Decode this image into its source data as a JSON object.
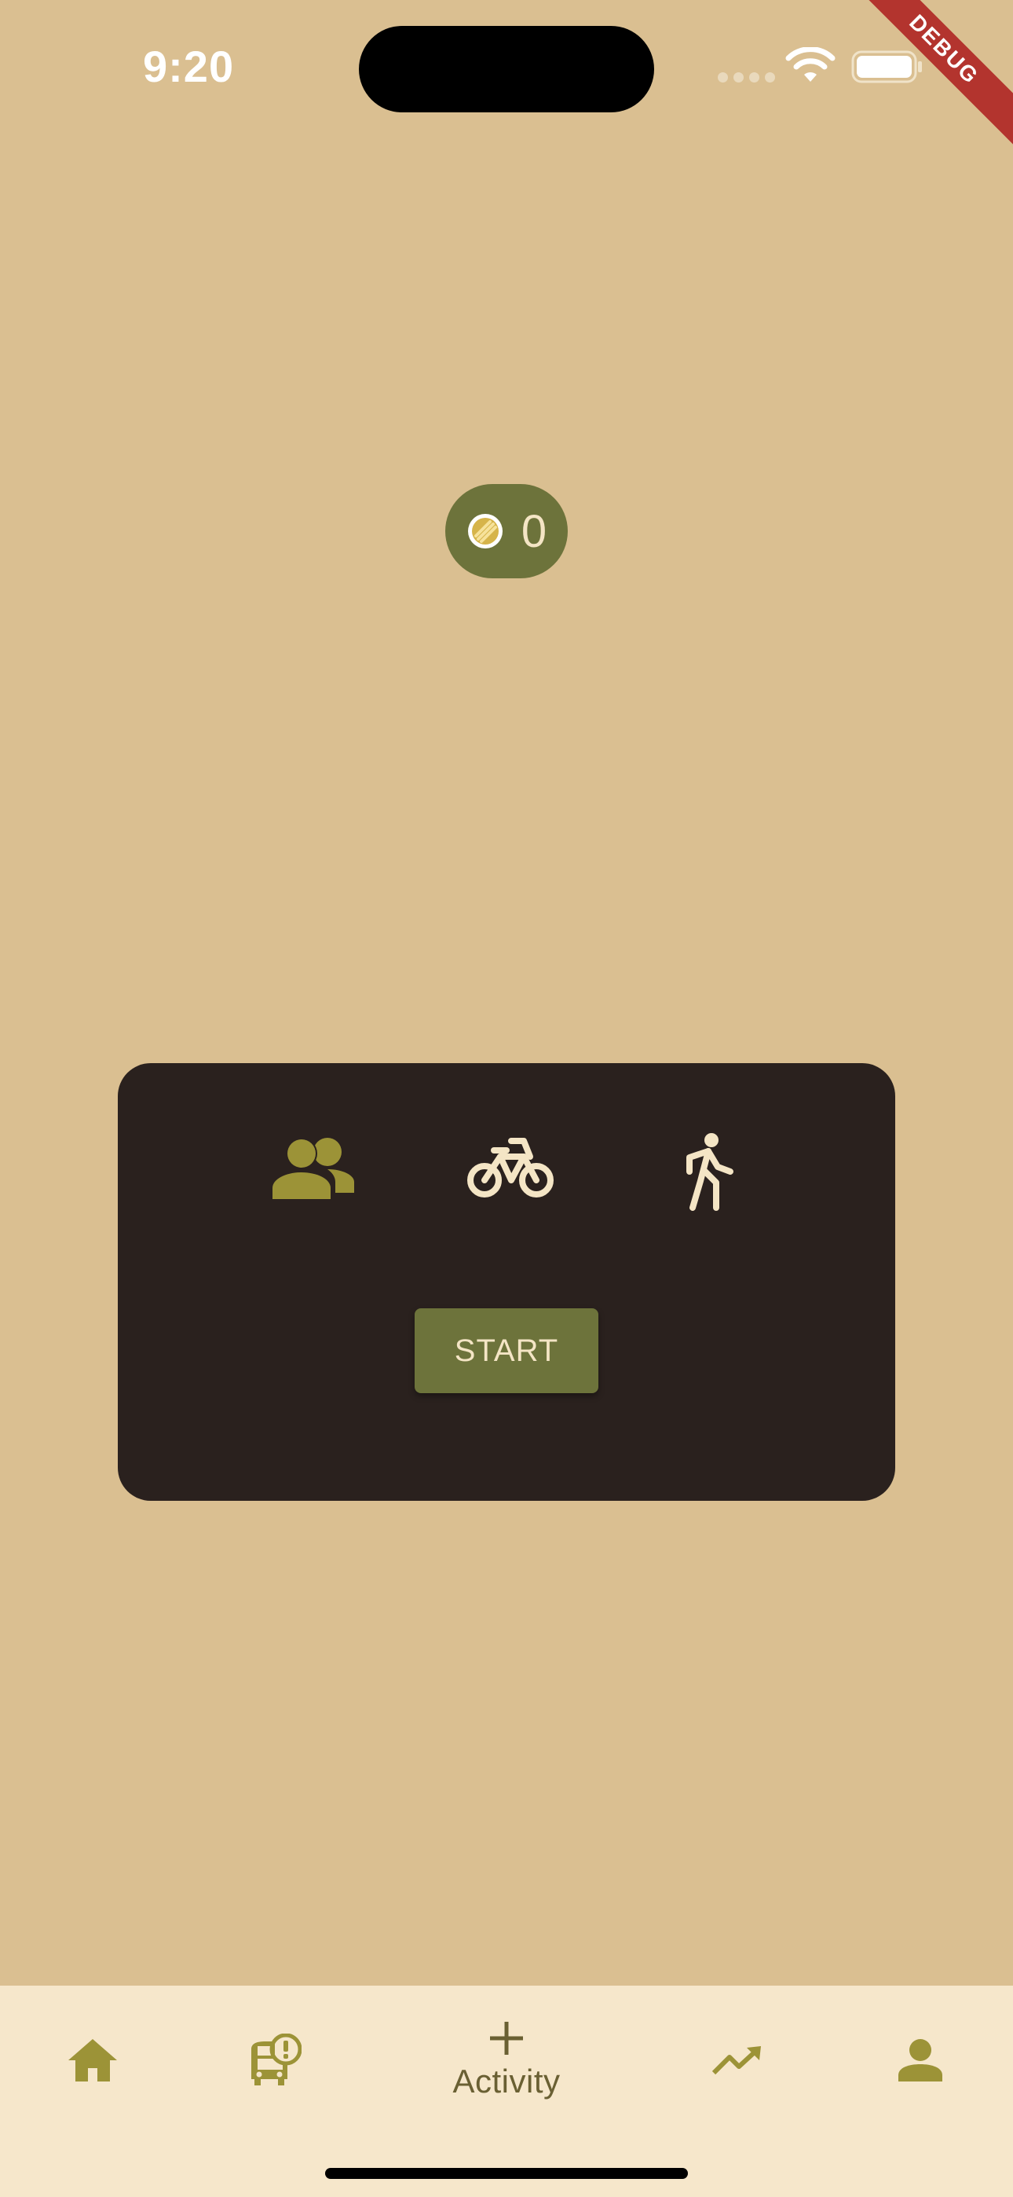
{
  "status_bar": {
    "time": "9:20"
  },
  "debug_banner": "DEBUG",
  "coins": {
    "count": "0",
    "icon": "coin-icon"
  },
  "activity_card": {
    "modes": [
      {
        "id": "group",
        "icon": "group-icon",
        "selected": true
      },
      {
        "id": "bike",
        "icon": "bike-icon",
        "selected": false
      },
      {
        "id": "walk",
        "icon": "walk-icon",
        "selected": false
      }
    ],
    "start_label": "START"
  },
  "bottom_nav": {
    "items": [
      {
        "id": "home",
        "icon": "home-icon"
      },
      {
        "id": "transit",
        "icon": "bus-alert-icon"
      },
      {
        "id": "activity",
        "icon": "plus-icon",
        "label": "Activity"
      },
      {
        "id": "stats",
        "icon": "trending-up-icon"
      },
      {
        "id": "profile",
        "icon": "person-icon"
      }
    ]
  },
  "colors": {
    "background": "#DABF91",
    "accent": "#6D733B",
    "card": "#2A211E",
    "nav_background": "#F6E7CB",
    "icon_olive": "#9C9337",
    "icon_light": "#F4E5C5",
    "debug_red": "#B3342E"
  }
}
